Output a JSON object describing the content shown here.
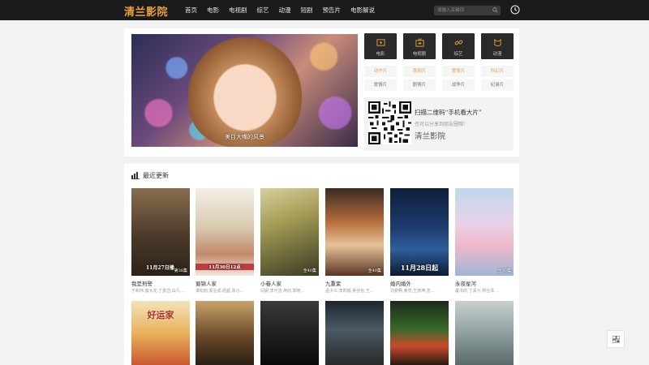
{
  "header": {
    "logo": "清兰影院",
    "nav": [
      "首页",
      "电影",
      "电视剧",
      "综艺",
      "动漫",
      "短剧",
      "预告片",
      "电影解说"
    ],
    "search_placeholder": "请输入关键词"
  },
  "banner": {
    "caption": "美目大嘴的风景"
  },
  "categories": [
    {
      "label": "电影",
      "icon": "play-screen-icon"
    },
    {
      "label": "电视剧",
      "icon": "tv-icon"
    },
    {
      "label": "综艺",
      "icon": "link-icon"
    },
    {
      "label": "动漫",
      "icon": "cat-icon"
    }
  ],
  "subcategories": [
    "动作片",
    "喜剧片",
    "爱情片",
    "科幻片",
    "爱情片",
    "剧情片",
    "战争片",
    "纪录片"
  ],
  "qr": {
    "title": "扫描二维码“手机看大片”",
    "subtitle": "也可以分享到朋友圈哦!",
    "brand": "清兰影院"
  },
  "recent": {
    "title": "最近更新",
    "row1": [
      {
        "title": "我是刑警",
        "cast": "于和伟,富大龙,丁勇岱,白凡,...",
        "badge": "第38集",
        "overlay": "11月27日播"
      },
      {
        "title": "蜀锦人家",
        "cast": "谭松韵,郑业成,经超,陈小...",
        "badge": "",
        "overlay": "11月30日12点"
      },
      {
        "title": "小巷人家",
        "cast": "闫妮,李光洁,蒋欣,郭晓...",
        "badge": "全40集",
        "overlay": ""
      },
      {
        "title": "九重紫",
        "cast": "孟子义,李昀锐,吴佳怡,王...",
        "badge": "全40集",
        "overlay": ""
      },
      {
        "title": "婚内婚外",
        "cast": "刘奕畅,黄觉,王丽坤,曾...",
        "badge": "",
        "overlay": "11月28日起"
      },
      {
        "title": "永夜星河",
        "cast": "虞书欣,丁禹兮,杨仕泽,...",
        "badge": "全30集",
        "overlay": ""
      }
    ],
    "row2": [
      {
        "overlay": "好运家"
      },
      {
        "overlay": ""
      },
      {
        "overlay": ""
      },
      {
        "overlay": ""
      },
      {
        "overlay": ""
      },
      {
        "overlay": ""
      }
    ]
  },
  "colors": {
    "topbar": "#1b1b1b",
    "accent": "#e8a33a"
  }
}
